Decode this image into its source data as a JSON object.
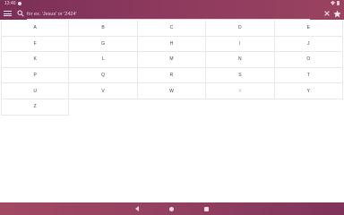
{
  "status_bar": {
    "time": "13:40"
  },
  "toolbar": {
    "search_placeholder": "for ex. 'Jesus' or '2424'",
    "menu_icon": "hamburger-menu-icon",
    "search_icon": "search-icon",
    "clear_icon": "close-icon",
    "favorite_icon": "star-icon"
  },
  "letters": [
    "A",
    "B",
    "C",
    "D",
    "E",
    "F",
    "G",
    "H",
    "I",
    "J",
    "K",
    "L",
    "M",
    "N",
    "O",
    "P",
    "Q",
    "R",
    "S",
    "T",
    "U",
    "V",
    "W",
    "X",
    "Y",
    "Z"
  ],
  "faded_letters": [
    "X"
  ],
  "nav_bar": {
    "back_icon": "back-icon",
    "home_icon": "home-icon",
    "recents_icon": "recents-icon"
  },
  "colors": {
    "accent": "#8e3a5e",
    "nav": "#934060"
  }
}
